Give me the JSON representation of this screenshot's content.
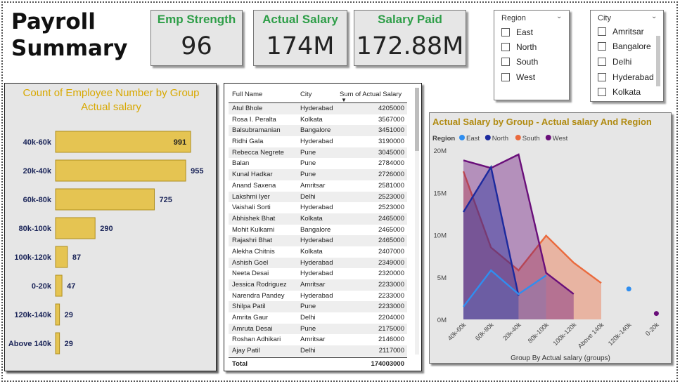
{
  "title": "Payroll Summary",
  "kpis": [
    {
      "label": "Emp Strength",
      "value": "96"
    },
    {
      "label": "Actual Salary",
      "value": "174M"
    },
    {
      "label": "Salary Paid",
      "value": "172.88M"
    }
  ],
  "region_slicer": {
    "title": "Region",
    "options": [
      "East",
      "North",
      "South",
      "West"
    ]
  },
  "city_slicer": {
    "title": "City",
    "options": [
      "Amritsar",
      "Bangalore",
      "Delhi",
      "Hyderabad",
      "Kolkata"
    ]
  },
  "table": {
    "columns": [
      "Full Name",
      "City",
      "Sum of Actual Salary"
    ],
    "rows": [
      [
        "Atul Bhole",
        "Hyderabad",
        "4205000"
      ],
      [
        "Rosa I. Peralta",
        "Kolkata",
        "3567000"
      ],
      [
        "Balsubramanian",
        "Bangalore",
        "3451000"
      ],
      [
        "Ridhi Gala",
        "Hyderabad",
        "3190000"
      ],
      [
        "Rebecca Negrete",
        "Pune",
        "3045000"
      ],
      [
        "Balan",
        "Pune",
        "2784000"
      ],
      [
        "Kunal Hadkar",
        "Pune",
        "2726000"
      ],
      [
        "Anand Saxena",
        "Amritsar",
        "2581000"
      ],
      [
        "Lakshmi Iyer",
        "Delhi",
        "2523000"
      ],
      [
        "Vaishali Sorti",
        "Hyderabad",
        "2523000"
      ],
      [
        "Abhishek Bhat",
        "Kolkata",
        "2465000"
      ],
      [
        "Mohit Kulkarni",
        "Bangalore",
        "2465000"
      ],
      [
        "Rajashri Bhat",
        "Hyderabad",
        "2465000"
      ],
      [
        "Alekha Chitnis",
        "Kolkata",
        "2407000"
      ],
      [
        "Ashish Goel",
        "Hyderabad",
        "2349000"
      ],
      [
        "Neeta Desai",
        "Hyderabad",
        "2320000"
      ],
      [
        "Jessica Rodriguez",
        "Amritsar",
        "2233000"
      ],
      [
        "Narendra Pandey",
        "Hyderabad",
        "2233000"
      ],
      [
        "Shilpa Patil",
        "Pune",
        "2233000"
      ],
      [
        "Amrita Gaur",
        "Delhi",
        "2204000"
      ],
      [
        "Amruta Desai",
        "Pune",
        "2175000"
      ],
      [
        "Roshan Adhikari",
        "Amritsar",
        "2146000"
      ],
      [
        "Ajay Patil",
        "Delhi",
        "2117000"
      ]
    ],
    "total_label": "Total",
    "total_value": "174003000"
  },
  "colors": {
    "kpi_label": "#2e9e48",
    "bar": "#e5c452",
    "bar_title": "#d8a800",
    "area_title": "#b08a10",
    "east": "#2f8ef0",
    "north": "#1c2a9e",
    "south": "#ea6a3d",
    "west": "#6a0f7a"
  },
  "chart_data": [
    {
      "type": "bar",
      "orientation": "horizontal",
      "title": "Count of Employee Number by Group Actual salary",
      "categories": [
        "40k-60k",
        "20k-40k",
        "60k-80k",
        "80k-100k",
        "100k-120k",
        "0-20k",
        "120k-140k",
        "Above 140k"
      ],
      "values": [
        991,
        955,
        725,
        290,
        87,
        47,
        29,
        29
      ],
      "data_labels": [
        "991",
        "955",
        "725",
        "290",
        "87",
        "47",
        "29",
        "29"
      ]
    },
    {
      "type": "area",
      "title": "Actual Salary by Group - Actual salary And Region",
      "legend_title": "Region",
      "xlabel": "Group By Actual salary (groups)",
      "categories": [
        "40k-60k",
        "60k-80k",
        "20k-40k",
        "80k-100k",
        "100k-120k",
        "Above 140k",
        "120k-140k",
        "0-20k"
      ],
      "yticks": [
        "0M",
        "5M",
        "10M",
        "15M",
        "20M"
      ],
      "ylim": [
        0,
        20
      ],
      "series": [
        {
          "name": "East",
          "values": [
            1.5,
            5.8,
            3.0,
            5.2,
            null,
            null,
            3.6,
            null
          ]
        },
        {
          "name": "North",
          "values": [
            12.7,
            18.0,
            2.8,
            null,
            null,
            null,
            null,
            null
          ]
        },
        {
          "name": "South",
          "values": [
            17.5,
            8.5,
            5.8,
            9.9,
            6.7,
            4.3,
            null,
            null
          ]
        },
        {
          "name": "West",
          "values": [
            18.8,
            17.9,
            19.5,
            5.5,
            3.0,
            null,
            null,
            0.7
          ]
        }
      ]
    }
  ]
}
